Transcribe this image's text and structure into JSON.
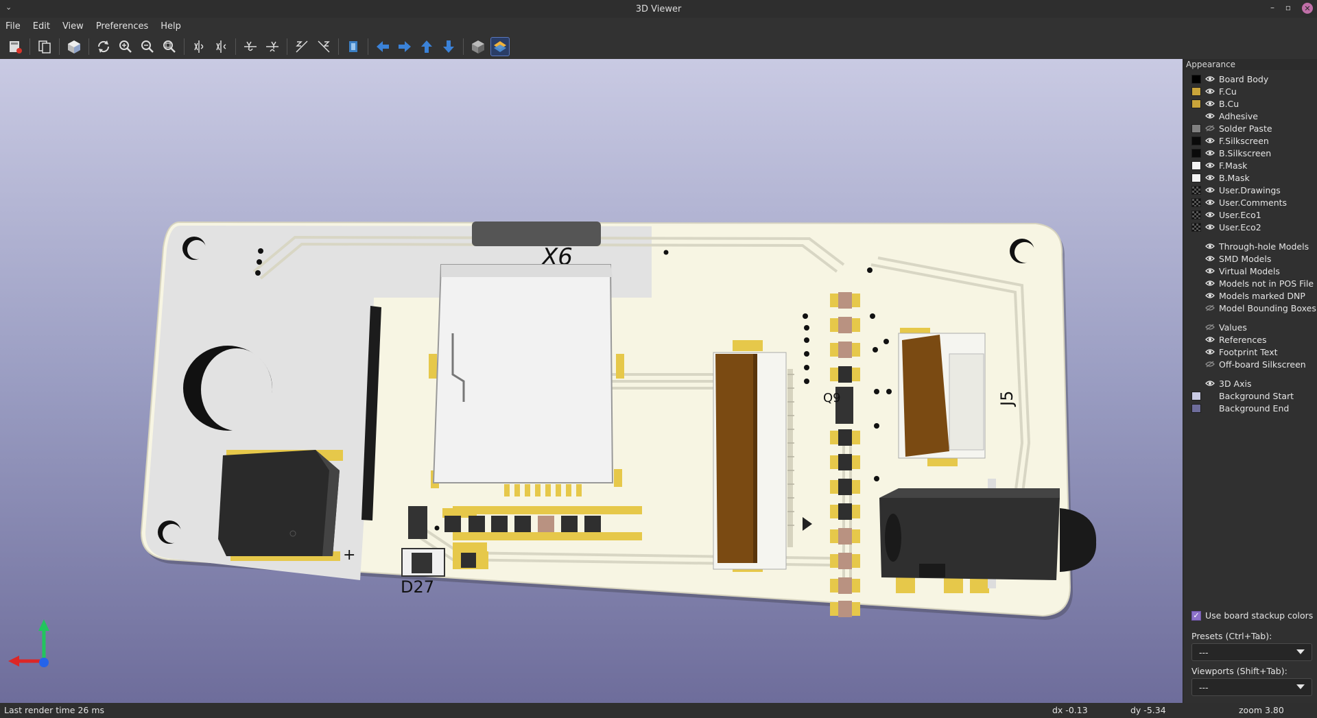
{
  "window": {
    "title": "3D Viewer",
    "menu_glyph": "⌄",
    "minimize": "–",
    "maximize": "▫",
    "close": "✕"
  },
  "menubar": {
    "items": [
      "File",
      "Edit",
      "View",
      "Preferences",
      "Help"
    ]
  },
  "toolbar": {
    "icons": [
      "export-icon",
      "copy-icon",
      "raytrace-icon",
      "reload-icon",
      "zoom-in-icon",
      "zoom-out-icon",
      "zoom-fit-icon",
      "rotate-x-cw-icon",
      "rotate-x-ccw-icon",
      "rotate-y-cw-icon",
      "rotate-y-ccw-icon",
      "rotate-z-cw-icon",
      "rotate-z-ccw-icon",
      "flip-board-icon",
      "move-left-icon",
      "move-right-icon",
      "move-up-icon",
      "move-down-icon",
      "ortho-icon",
      "layers-manager-icon"
    ]
  },
  "viewport": {
    "board_labels": {
      "sd": "X6",
      "j5": "J5",
      "q": "Q9",
      "d27": "D27",
      "plus": "+"
    },
    "colors": {
      "board": "#f7f5e3",
      "background_start": "#c9cae3",
      "background_end": "#6e6d9b",
      "copper": "#e6c84a",
      "connector": "#7a4a12",
      "jack": "#2f2f2f"
    }
  },
  "panel": {
    "title": "Appearance",
    "layers": [
      {
        "label": "Board Body",
        "color": "#000000",
        "visible": true
      },
      {
        "label": "F.Cu",
        "color": "#c9a43a",
        "visible": true
      },
      {
        "label": "B.Cu",
        "color": "#c9a43a",
        "visible": true
      },
      {
        "label": "Adhesive",
        "color": "",
        "visible": true
      },
      {
        "label": "Solder Paste",
        "color": "#808080",
        "visible": false
      },
      {
        "label": "F.Silkscreen",
        "color": "#0a0a0a",
        "visible": true
      },
      {
        "label": "B.Silkscreen",
        "color": "#0a0a0a",
        "visible": true
      },
      {
        "label": "F.Mask",
        "color": "#f4f4f4",
        "visible": true
      },
      {
        "label": "B.Mask",
        "color": "#f4f4f4",
        "visible": true
      },
      {
        "label": "User.Drawings",
        "color": "checker",
        "visible": true
      },
      {
        "label": "User.Comments",
        "color": "checker",
        "visible": true
      },
      {
        "label": "User.Eco1",
        "color": "checker",
        "visible": true
      },
      {
        "label": "User.Eco2",
        "color": "checker",
        "visible": true
      }
    ],
    "models": [
      {
        "label": "Through-hole Models",
        "visible": true
      },
      {
        "label": "SMD Models",
        "visible": true
      },
      {
        "label": "Virtual Models",
        "visible": true
      },
      {
        "label": "Models not in POS File",
        "visible": true
      },
      {
        "label": "Models marked DNP",
        "visible": true
      },
      {
        "label": "Model Bounding Boxes",
        "visible": false
      }
    ],
    "text_items": [
      {
        "label": "Values",
        "visible": false
      },
      {
        "label": "References",
        "visible": true
      },
      {
        "label": "Footprint Text",
        "visible": true
      },
      {
        "label": "Off-board Silkscreen",
        "visible": false
      }
    ],
    "misc": [
      {
        "label": "3D Axis",
        "color": "",
        "visible": true
      },
      {
        "label": "Background Start",
        "color": "#c9cae3",
        "visible": null
      },
      {
        "label": "Background End",
        "color": "#6e6d9b",
        "visible": null
      }
    ],
    "stackup_label": "Use board stackup colors",
    "presets_label": "Presets (Ctrl+Tab):",
    "presets_value": "---",
    "viewports_label": "Viewports (Shift+Tab):",
    "viewports_value": "---"
  },
  "status": {
    "render_time": "Last render time 26 ms",
    "dx": "dx -0.13",
    "dy": "dy -5.34",
    "zoom": "zoom 3.80"
  }
}
